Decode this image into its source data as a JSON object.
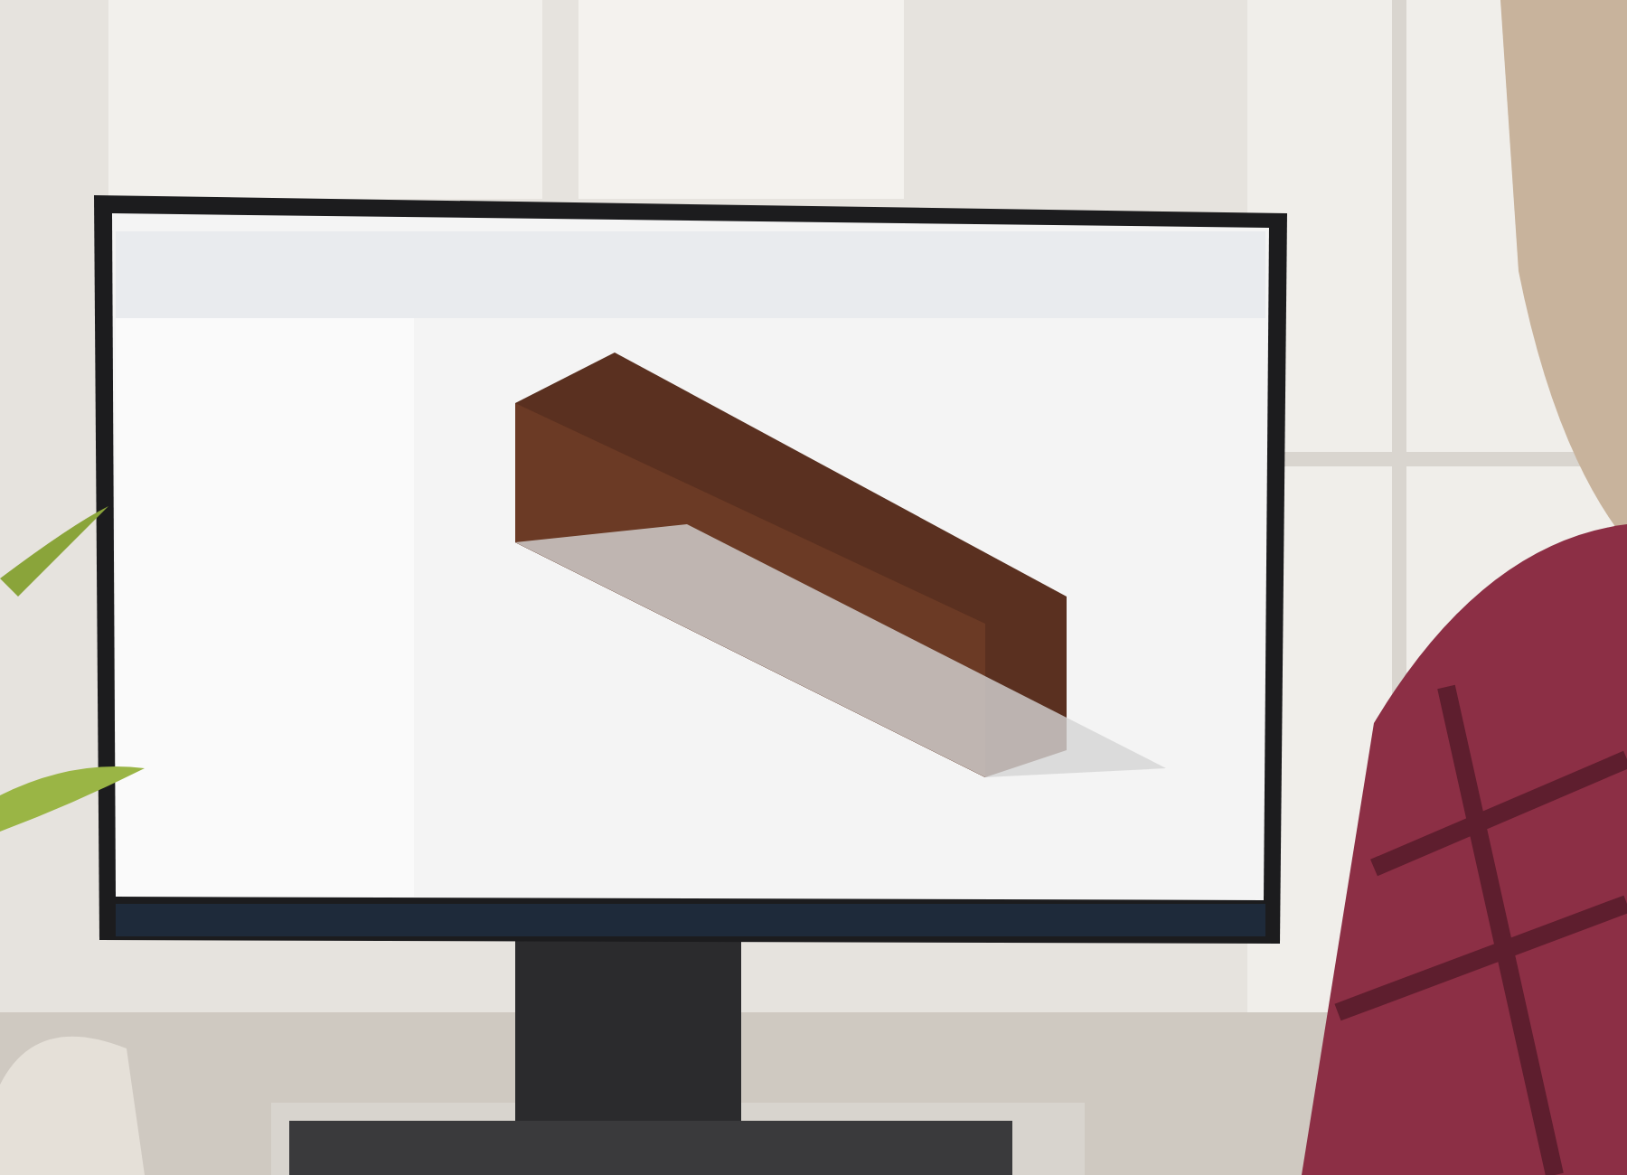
{
  "photo": {
    "kind": "photo"
  }
}
